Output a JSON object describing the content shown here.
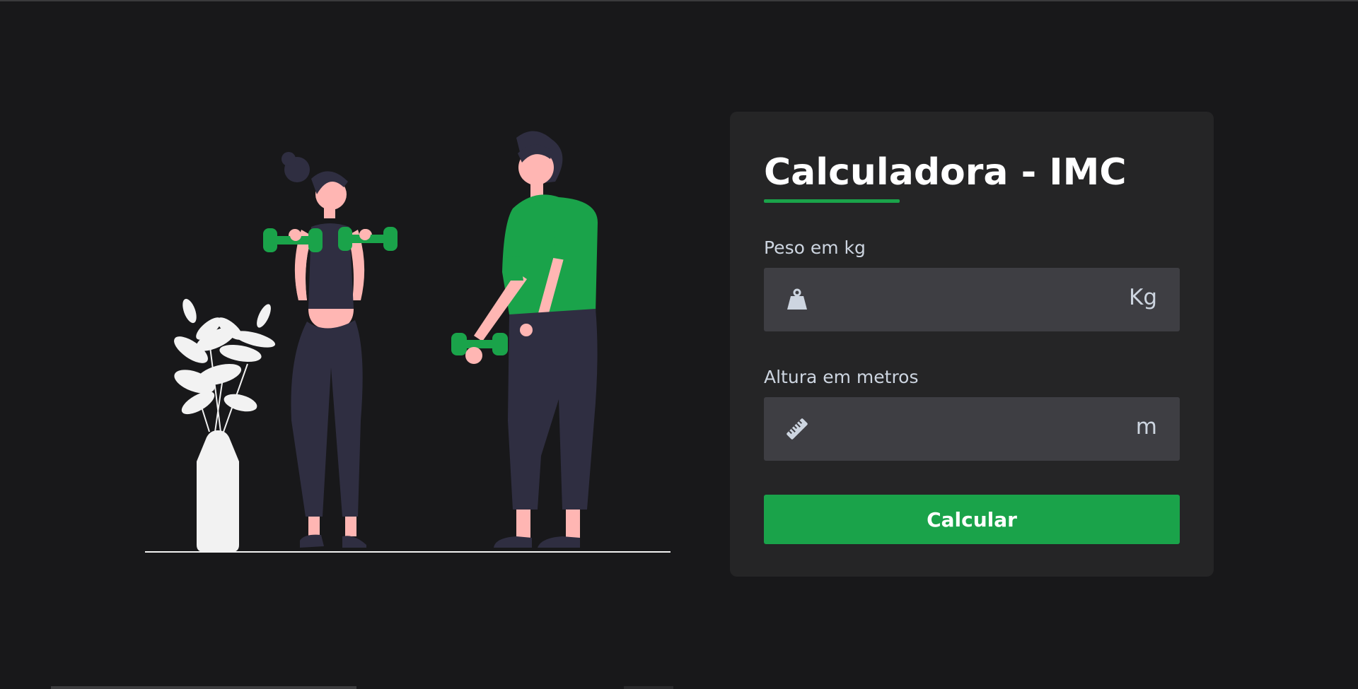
{
  "card": {
    "title": "Calculadora - IMC",
    "weight": {
      "label": "Peso em kg",
      "unit": "Kg",
      "icon": "weight-icon",
      "value": ""
    },
    "height": {
      "label": "Altura em metros",
      "unit": "m",
      "icon": "ruler-icon",
      "value": ""
    },
    "button_label": "Calcular"
  },
  "colors": {
    "background": "#18181a",
    "card": "#252526",
    "input": "#3e3e43",
    "accent": "#1aa34a",
    "skin": "#ffb6b3",
    "clothing_dark": "#2f2e41",
    "plant": "#f2f2f2"
  }
}
